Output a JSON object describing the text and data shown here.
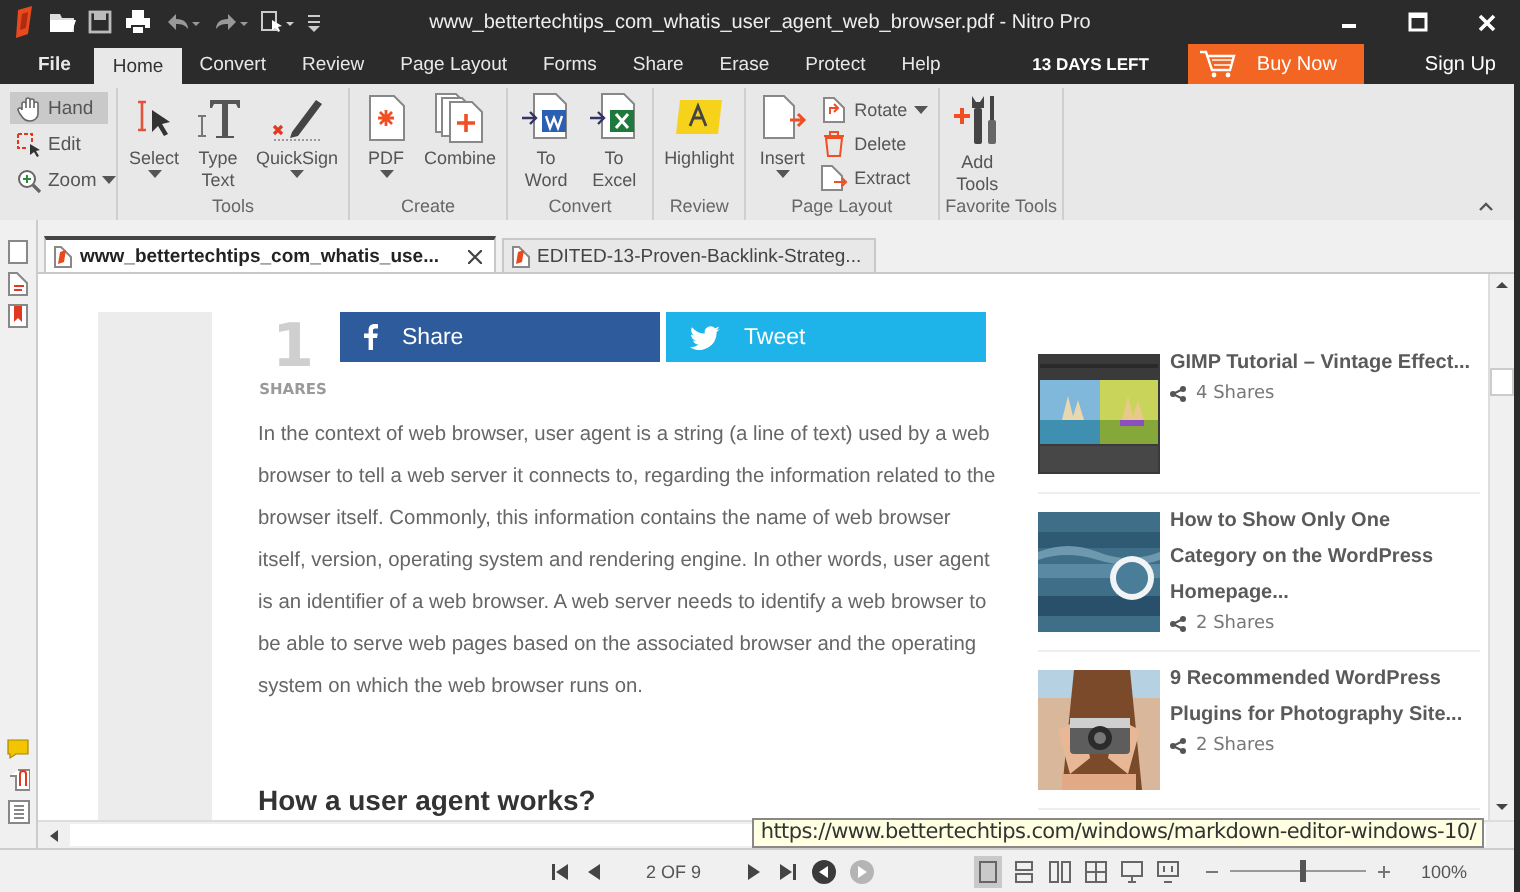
{
  "window": {
    "title": "www_bettertechtips_com_whatis_user_agent_web_browser.pdf - Nitro Pro"
  },
  "menu_tabs": [
    {
      "label": "File",
      "selected": false
    },
    {
      "label": "Home",
      "selected": true
    },
    {
      "label": "Convert",
      "selected": false
    },
    {
      "label": "Review",
      "selected": false
    },
    {
      "label": "Page Layout",
      "selected": false
    },
    {
      "label": "Forms",
      "selected": false
    },
    {
      "label": "Share",
      "selected": false
    },
    {
      "label": "Erase",
      "selected": false
    },
    {
      "label": "Protect",
      "selected": false
    },
    {
      "label": "Help",
      "selected": false
    }
  ],
  "trial": {
    "days_left": "13 DAYS LEFT",
    "buy_button": "Buy Now",
    "sign_up": "Sign Up"
  },
  "ribbon": {
    "hand_tools": [
      {
        "label": "Hand",
        "selected": true,
        "dropdown": false
      },
      {
        "label": "Edit",
        "selected": false,
        "dropdown": false
      },
      {
        "label": "Zoom",
        "selected": false,
        "dropdown": true
      }
    ],
    "groups": [
      {
        "label": "Tools",
        "tools": [
          {
            "label": "Select",
            "dropdown": true
          },
          {
            "label": "Type Text",
            "dropdown": false
          },
          {
            "label": "QuickSign",
            "dropdown": true
          }
        ]
      },
      {
        "label": "Create",
        "tools": [
          {
            "label": "PDF",
            "dropdown": true
          },
          {
            "label": "Combine",
            "dropdown": false
          }
        ]
      },
      {
        "label": "Convert",
        "tools": [
          {
            "label": "To Word",
            "dropdown": false
          },
          {
            "label": "To Excel",
            "dropdown": false
          }
        ]
      },
      {
        "label": "Review",
        "tools": [
          {
            "label": "Highlight",
            "dropdown": false
          }
        ]
      },
      {
        "label": "Page Layout",
        "tools": [
          {
            "label": "Insert",
            "dropdown": true
          }
        ],
        "small_tools": [
          {
            "label": "Rotate",
            "dropdown": true
          },
          {
            "label": "Delete",
            "dropdown": false
          },
          {
            "label": "Extract",
            "dropdown": false
          }
        ]
      },
      {
        "label": "Favorite Tools",
        "tools": [
          {
            "label": "Add Tools",
            "dropdown": false
          }
        ]
      }
    ]
  },
  "doc_tabs": [
    {
      "label": "www_bettertechtips_com_whatis_use...",
      "selected": true
    },
    {
      "label": "EDITED-13-Proven-Backlink-Strateg...",
      "selected": false
    }
  ],
  "article": {
    "share_count": "1",
    "share_label": "SHARES",
    "share_buttons": [
      {
        "kind": "facebook",
        "label": "Share"
      },
      {
        "kind": "twitter",
        "label": "Tweet"
      }
    ],
    "paragraph": "In the context of web browser, user agent is a string (a line of text) used by a web browser to tell a web server it connects to, regarding the information related to the browser itself. Commonly, this information contains the name of web browser itself, version, operating system and rendering engine. In other words, user agent is an identifier of a web browser. A web server needs to identify a web browser to be able to serve web pages based on the associated browser and the operating system on which the web browser runs on.",
    "heading": "How a user agent works?"
  },
  "related_posts": [
    {
      "title": "GIMP Tutorial – Vintage Effect...",
      "shares": "4 Shares"
    },
    {
      "title": "How to Show Only One Category on the WordPress Homepage...",
      "shares": "2 Shares"
    },
    {
      "title": "9 Recommended WordPress Plugins for Photography Site...",
      "shares": "2 Shares"
    }
  ],
  "tooltip": "https://www.bettertechtips.com/windows/markdown-editor-windows-10/",
  "status_bar": {
    "page": "2 OF 9",
    "history": [
      {
        "disabled": false
      },
      {
        "disabled": true
      }
    ],
    "view_modes": [
      {
        "selected": true
      },
      {
        "selected": false
      },
      {
        "selected": false
      },
      {
        "selected": false
      },
      {
        "selected": false
      },
      {
        "selected": false
      }
    ],
    "zoom": {
      "level": 0.53,
      "reading": "100%"
    }
  }
}
